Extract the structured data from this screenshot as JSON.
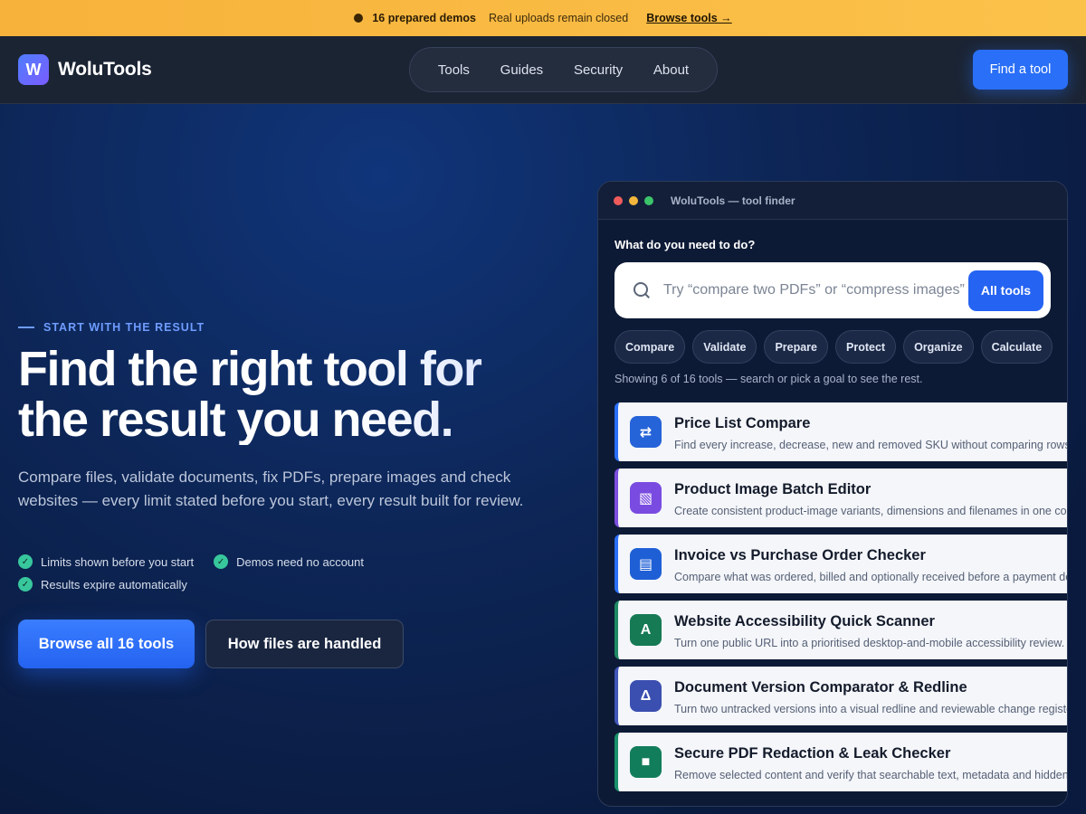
{
  "banner": {
    "demos": "16 prepared demos",
    "uploads": "Real uploads remain closed",
    "link": "Browse tools →"
  },
  "brand": {
    "logo": "W",
    "name": "WoluTools"
  },
  "nav": {
    "items": [
      "Tools",
      "Guides",
      "Security",
      "About"
    ]
  },
  "header": {
    "find_label": "Find a tool"
  },
  "hero": {
    "eyebrow": "START WITH THE RESULT",
    "headline": "Find the right tool for the result you need.",
    "subtext": "Compare files, validate documents, fix PDFs, prepare images and check websites — every limit stated before you start, every result built for review.",
    "checks": [
      "Limits shown before you start",
      "Demos need no account",
      "Results expire automatically"
    ],
    "cta_primary": "Browse all 16 tools",
    "cta_secondary": "How files are handled"
  },
  "finder": {
    "window_title": "WoluTools — tool finder",
    "question": "What do you need to do?",
    "search_placeholder": "Try “compare two PDFs” or “compress images”",
    "search_button": "All tools",
    "chips": [
      "Compare",
      "Validate",
      "Prepare",
      "Protect",
      "Organize",
      "Calculate"
    ],
    "showing": "Showing 6 of 16 tools — search or pick a goal to see the rest.",
    "tools": [
      {
        "title": "Price List Compare",
        "desc": "Find every increase, decrease, new and removed SKU without comparing rows by hand.",
        "glyph": "⇄",
        "icon": "swap-arrows-icon",
        "accent": "#2a6ff7",
        "bg": "#2563d8"
      },
      {
        "title": "Product Image Batch Editor",
        "desc": "Create consistent product-image variants, dimensions and filenames in one confident pass.",
        "glyph": "▧",
        "icon": "image-grid-icon",
        "accent": "#7c4ddf",
        "bg": "#7a4be0"
      },
      {
        "title": "Invoice vs Purchase Order Checker",
        "desc": "Compare what was ordered, billed and optionally received before a payment decision.",
        "glyph": "▤",
        "icon": "document-icon",
        "accent": "#2a6ff7",
        "bg": "#1f5fd6"
      },
      {
        "title": "Website Accessibility Quick Scanner",
        "desc": "Turn one public URL into a prioritised desktop-and-mobile accessibility review.",
        "glyph": "A",
        "icon": "accessibility-icon",
        "accent": "#1d8a63",
        "bg": "#167a55"
      },
      {
        "title": "Document Version Comparator & Redline",
        "desc": "Turn two untracked versions into a visual redline and reviewable change register.",
        "glyph": "Δ",
        "icon": "delta-icon",
        "accent": "#3f55b8",
        "bg": "#3a4fb0"
      },
      {
        "title": "Secure PDF Redaction & Leak Checker",
        "desc": "Remove selected content and verify that searchable text, metadata and hidden data are gone.",
        "glyph": "■",
        "icon": "redaction-icon",
        "accent": "#18906a",
        "bg": "#127d5b"
      }
    ]
  }
}
